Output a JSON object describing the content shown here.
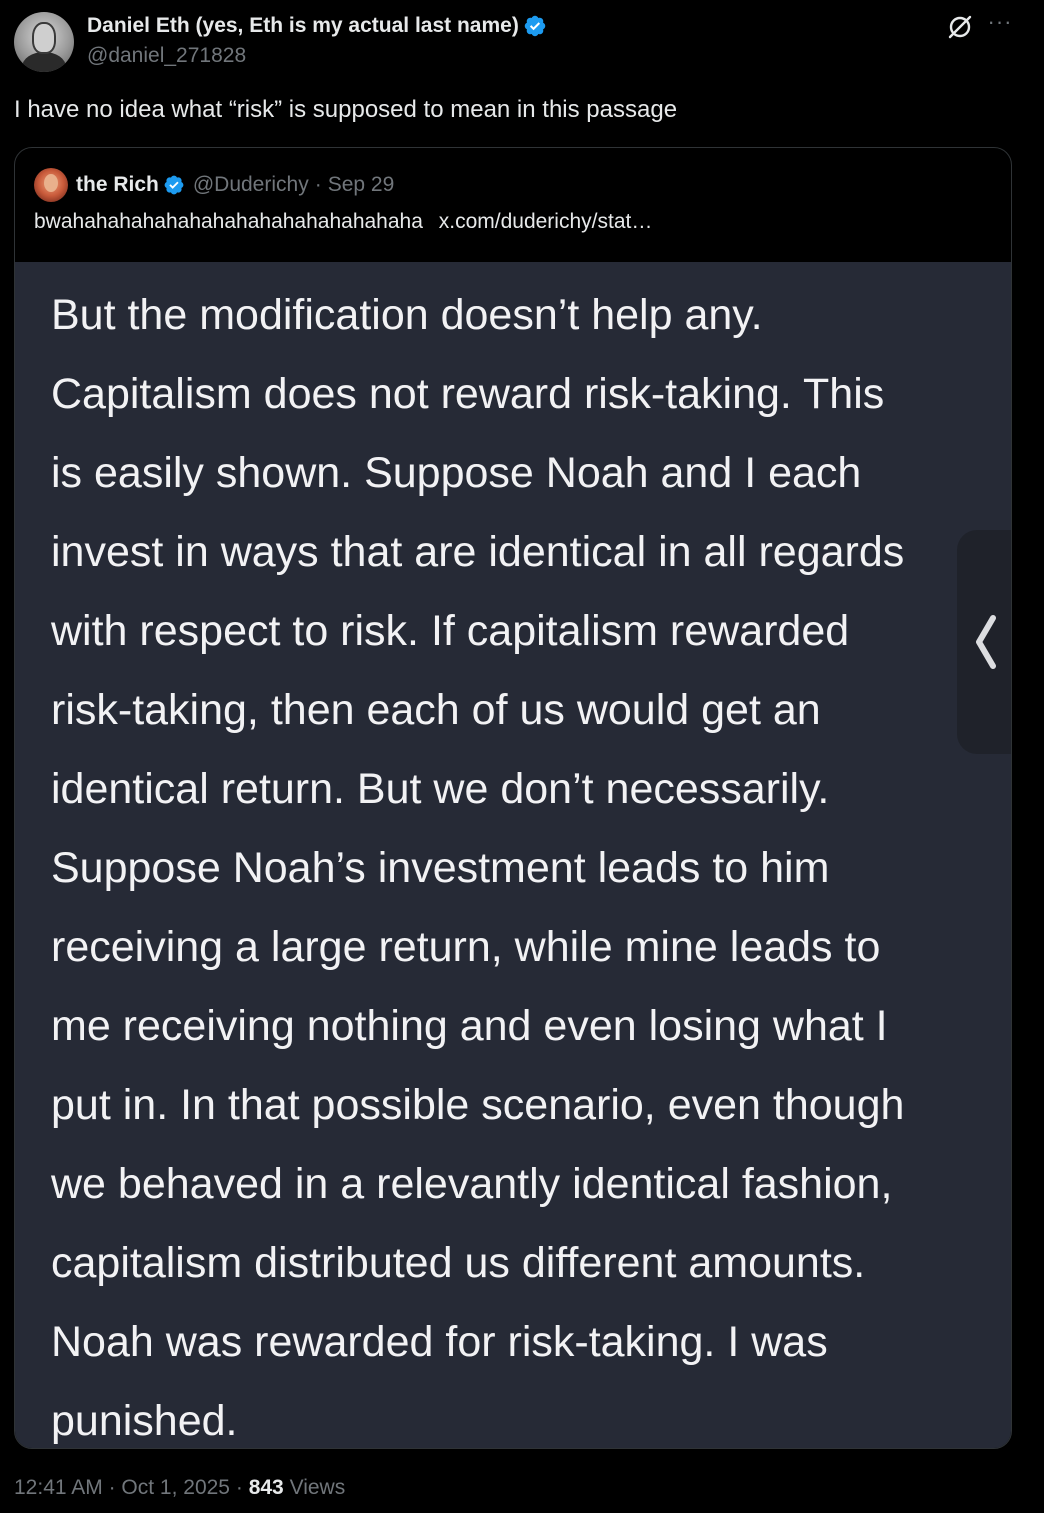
{
  "author": {
    "display_name": "Daniel Eth (yes, Eth is my actual last name)",
    "handle": "@daniel_271828",
    "verified": true
  },
  "icons": {
    "verified": "verified-badge-icon",
    "grok": "grok-icon",
    "more": "more-options-icon",
    "chevron": "chevron-left-icon"
  },
  "colors": {
    "verified_blue": "#1d9bf0",
    "muted_text": "#71767b",
    "image_background": "#262a36"
  },
  "tweet": {
    "text": "I have no idea what “risk” is supposed to mean in this passage"
  },
  "quote": {
    "display_name": "the Rich",
    "handle": "@Duderichy",
    "separator": "·",
    "date": "Sep 29",
    "text": "bwahahahahahahahahahahahahahahaha",
    "link": "x.com/duderichy/stat…",
    "image_text": "But the modification doesn’t help any.\nCapitalism does not reward risk-taking. This\nis easily shown. Suppose Noah and I each\ninvest in ways that are identical in all regards\nwith respect to risk. If capitalism rewarded\nrisk-taking, then each of us would get an\nidentical return. But we don’t necessarily.\nSuppose Noah’s investment leads to him\nreceiving a large return, while mine leads to\nme receiving nothing and even losing what I\nput in. In that possible scenario, even though\nwe behaved in a relevantly identical fashion,\ncapitalism distributed us different amounts.\nNoah was rewarded for risk-taking. I was\npunished."
  },
  "footer": {
    "time": "12:41 AM",
    "separator": "·",
    "date": "Oct 1, 2025",
    "views_count": "843",
    "views_label": "Views"
  }
}
